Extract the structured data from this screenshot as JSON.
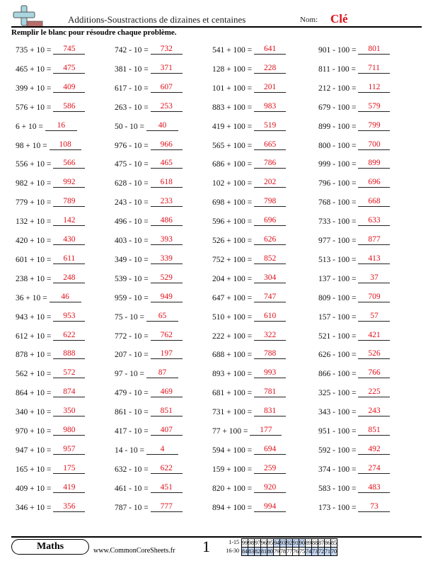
{
  "header": {
    "title": "Additions-Soustractions de dizaines et centaines",
    "nom_label": "Nom:",
    "nom_value": "Clé",
    "instructions": "Remplir le blanc pour résoudre chaque problème."
  },
  "colors": {
    "answer": "#e0101a",
    "logo_cross": "#a9d6e0",
    "logo_bar": "#b86d6a",
    "score_highlight": "#c7d9f4"
  },
  "logo_icon": "plus-minus-icon",
  "problems": [
    [
      "735 + 10 =",
      "745",
      "742 - 10 =",
      "732",
      "541 + 100 =",
      "641",
      "901 - 100 =",
      "801"
    ],
    [
      "465 + 10 =",
      "475",
      "381 - 10 =",
      "371",
      "128 + 100 =",
      "228",
      "811 - 100 =",
      "711"
    ],
    [
      "399 + 10 =",
      "409",
      "617 - 10 =",
      "607",
      "101 + 100 =",
      "201",
      "212 - 100 =",
      "112"
    ],
    [
      "576 + 10 =",
      "586",
      "263 - 10 =",
      "253",
      "883 + 100 =",
      "983",
      "679 - 100 =",
      "579"
    ],
    [
      "6 + 10 =",
      "16",
      "50 - 10 =",
      "40",
      "419 + 100 =",
      "519",
      "899 - 100 =",
      "799"
    ],
    [
      "98 + 10 =",
      "108",
      "976 - 10 =",
      "966",
      "565 + 100 =",
      "665",
      "800 - 100 =",
      "700"
    ],
    [
      "556 + 10 =",
      "566",
      "475 - 10 =",
      "465",
      "686 + 100 =",
      "786",
      "999 - 100 =",
      "899"
    ],
    [
      "982 + 10 =",
      "992",
      "628 - 10 =",
      "618",
      "102 + 100 =",
      "202",
      "796 - 100 =",
      "696"
    ],
    [
      "779 + 10 =",
      "789",
      "243 - 10 =",
      "233",
      "698 + 100 =",
      "798",
      "768 - 100 =",
      "668"
    ],
    [
      "132 + 10 =",
      "142",
      "496 - 10 =",
      "486",
      "596 + 100 =",
      "696",
      "733 - 100 =",
      "633"
    ],
    [
      "420 + 10 =",
      "430",
      "403 - 10 =",
      "393",
      "526 + 100 =",
      "626",
      "977 - 100 =",
      "877"
    ],
    [
      "601 + 10 =",
      "611",
      "349 - 10 =",
      "339",
      "752 + 100 =",
      "852",
      "513 - 100 =",
      "413"
    ],
    [
      "238 + 10 =",
      "248",
      "539 - 10 =",
      "529",
      "204 + 100 =",
      "304",
      "137 - 100 =",
      "37"
    ],
    [
      "36 + 10 =",
      "46",
      "959 - 10 =",
      "949",
      "647 + 100 =",
      "747",
      "809 - 100 =",
      "709"
    ],
    [
      "943 + 10 =",
      "953",
      "75 - 10 =",
      "65",
      "510 + 100 =",
      "610",
      "157 - 100 =",
      "57"
    ],
    [
      "612 + 10 =",
      "622",
      "772 - 10 =",
      "762",
      "222 + 100 =",
      "322",
      "521 - 100 =",
      "421"
    ],
    [
      "878 + 10 =",
      "888",
      "207 - 10 =",
      "197",
      "688 + 100 =",
      "788",
      "626 - 100 =",
      "526"
    ],
    [
      "562 + 10 =",
      "572",
      "97 - 10 =",
      "87",
      "893 + 100 =",
      "993",
      "866 - 100 =",
      "766"
    ],
    [
      "864 + 10 =",
      "874",
      "479 - 10 =",
      "469",
      "681 + 100 =",
      "781",
      "325 - 100 =",
      "225"
    ],
    [
      "340 + 10 =",
      "350",
      "861 - 10 =",
      "851",
      "731 + 100 =",
      "831",
      "343 - 100 =",
      "243"
    ],
    [
      "970 + 10 =",
      "980",
      "417 - 10 =",
      "407",
      "77 + 100 =",
      "177",
      "951 - 100 =",
      "851"
    ],
    [
      "947 + 10 =",
      "957",
      "14 - 10 =",
      "4",
      "594 + 100 =",
      "694",
      "592 - 100 =",
      "492"
    ],
    [
      "165 + 10 =",
      "175",
      "632 - 10 =",
      "622",
      "159 + 100 =",
      "259",
      "374 - 100 =",
      "274"
    ],
    [
      "409 + 10 =",
      "419",
      "461 - 10 =",
      "451",
      "820 + 100 =",
      "920",
      "583 - 100 =",
      "483"
    ],
    [
      "346 + 10 =",
      "356",
      "787 - 10 =",
      "777",
      "894 + 100 =",
      "994",
      "173 - 100 =",
      "73"
    ]
  ],
  "footer": {
    "subject": "Maths",
    "site": "www.CommonCoreSheets.fr",
    "page": "1",
    "score_rows": [
      {
        "label": "1-15",
        "values": [
          "99",
          "98",
          "97",
          "96",
          "95",
          "94",
          "93",
          "92",
          "91",
          "90",
          "89",
          "88",
          "87",
          "86",
          "85"
        ],
        "highlight": [
          false,
          false,
          false,
          false,
          false,
          true,
          true,
          true,
          true,
          true,
          false,
          false,
          false,
          false,
          false
        ]
      },
      {
        "label": "16-30",
        "values": [
          "84",
          "83",
          "82",
          "81",
          "80",
          "79",
          "78",
          "77",
          "76",
          "75",
          "74",
          "73",
          "72",
          "71",
          "70"
        ],
        "highlight": [
          true,
          true,
          true,
          true,
          true,
          false,
          false,
          false,
          false,
          false,
          true,
          true,
          true,
          true,
          true
        ]
      }
    ]
  }
}
